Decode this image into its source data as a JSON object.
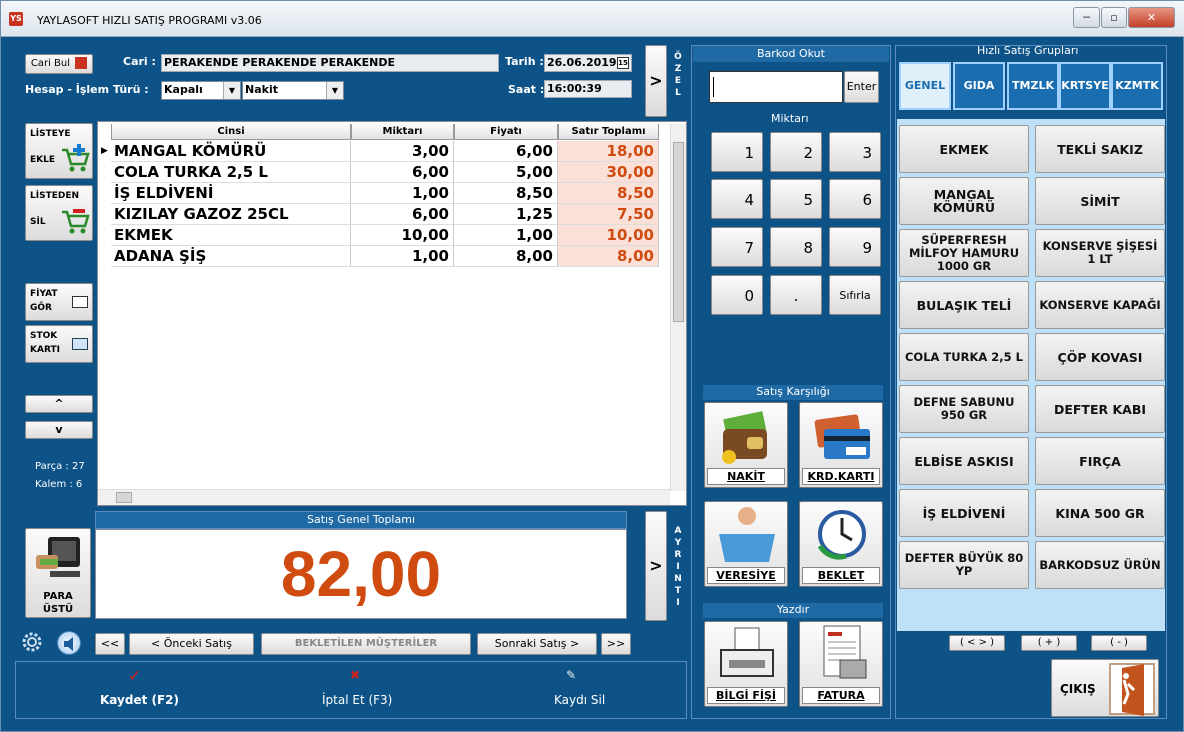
{
  "window": {
    "title": "YAYLASOFT HIZLI SATIŞ PROGRAMI v3.06",
    "minimize": "─",
    "restore": "▫",
    "close": "✕",
    "icon": "YS"
  },
  "header": {
    "cari_bul": "Cari Bul",
    "cari_label": "Cari :",
    "cari_value": "PERAKENDE PERAKENDE PERAKENDE",
    "hesap_label": "Hesap - İşlem Türü :",
    "hesap_value": "Kapalı",
    "islem_value": "Nakit",
    "tarih_label": "Tarih :",
    "tarih_value": "26.06.2019",
    "saat_label": "Saat :",
    "saat_value": "16:00:39",
    "ozel_btn": ">",
    "ozel_label": "ÖZEL"
  },
  "left": {
    "listeye_ekle": [
      "LİSTEYE",
      "EKLE"
    ],
    "listeden_sil": [
      "LİSTEDEN",
      "SİL"
    ],
    "fiyat_gor": [
      "FİYAT",
      "GÖR"
    ],
    "stok_karti": [
      "STOK",
      "KARTI"
    ],
    "up": "^",
    "down": "v",
    "parca": "Parça : 27",
    "kalem": "Kalem : 6",
    "para_ustu": [
      "PARA",
      "ÜSTÜ"
    ]
  },
  "grid": {
    "columns": [
      "Cinsi",
      "Miktarı",
      "Fiyatı",
      "Satır Toplamı"
    ],
    "rows": [
      [
        "MANGAL KÖMÜRÜ",
        "3,00",
        "6,00",
        "18,00"
      ],
      [
        "COLA TURKA 2,5 L",
        "6,00",
        "5,00",
        "30,00"
      ],
      [
        "İŞ ELDİVENİ",
        "1,00",
        "8,50",
        "8,50"
      ],
      [
        "KIZILAY GAZOZ 25CL",
        "6,00",
        "1,25",
        "7,50"
      ],
      [
        "EKMEK",
        "10,00",
        "1,00",
        "10,00"
      ],
      [
        "ADANA ŞİŞ",
        "1,00",
        "8,00",
        "8,00"
      ]
    ]
  },
  "total": {
    "label": "Satış Genel Toplamı",
    "value": "82,00",
    "ayrinti_btn": ">",
    "ayrinti_label": "AYRINTI"
  },
  "nav": {
    "first": "<<",
    "prev": "<  Önceki Satış",
    "waiting": "BEKLETİLEN MÜŞTERİLER",
    "next": "Sonraki Satış  >",
    "last": ">>"
  },
  "footer": {
    "kaydet": "Kaydet (F2)",
    "iptal": "İptal Et (F3)",
    "kaydi_sil": "Kaydı Sil"
  },
  "barcode": {
    "label": "Barkod Okut",
    "value": "",
    "enter": "Enter",
    "miktar_label": "Miktarı"
  },
  "keypad": [
    "1",
    "2",
    "3",
    "4",
    "5",
    "6",
    "7",
    "8",
    "9",
    "0",
    ".",
    "Sıfırla"
  ],
  "payment": {
    "label": "Satış Karşılığı",
    "nakit": "NAKİT",
    "kredi": "KRD.KARTI",
    "veresiye": "VERESİYE",
    "beklet": "BEKLET",
    "yazdir_label": "Yazdır",
    "bilgi_fisi": "BİLGİ FİŞİ",
    "fatura": "FATURA"
  },
  "quick": {
    "label": "Hızlı Satış Grupları",
    "groups": [
      "GENEL",
      "GIDA",
      "TMZLK",
      "KRTSYE",
      "KZMTK"
    ],
    "products": [
      "EKMEK",
      "TEKLİ SAKIZ",
      "MANGAL KÖMÜRÜ",
      "SİMİT",
      "SÜPERFRESH MİLFOY HAMURU 1000 GR",
      "KONSERVE ŞİŞESİ 1 LT",
      "BULAŞIK TELİ",
      "KONSERVE KAPAĞI",
      "COLA TURKA 2,5 L",
      "ÇÖP KOVASI",
      "DEFNE SABUNU 950 GR",
      "DEFTER KABI",
      "ELBİSE ASKISI",
      "FIRÇA",
      "İŞ ELDİVENİ",
      "KINA 500 GR",
      "DEFTER BÜYÜK 80 YP",
      "BARKODSUZ ÜRÜN"
    ],
    "page_btns": [
      "( < > )",
      "( + )",
      "( - )"
    ],
    "cikis": "ÇIKIŞ"
  },
  "colors": {
    "bg": "#0d5388",
    "total": "#d04b10",
    "tot_cell": "#fbe0d8"
  }
}
